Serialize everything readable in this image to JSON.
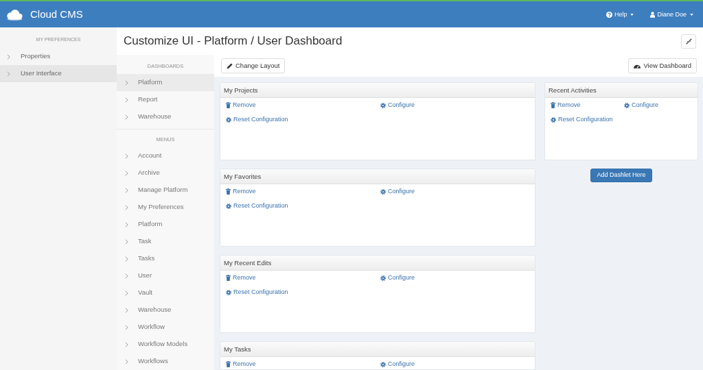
{
  "navbar": {
    "brand": "Cloud CMS",
    "menus": [
      {
        "kind": "help",
        "label": "Help"
      },
      {
        "kind": "user",
        "label": "Diane Doe"
      }
    ]
  },
  "sidebar": {
    "heading": "MY PREFERENCES",
    "items": [
      {
        "label": "Properties",
        "selected": false
      },
      {
        "label": "User Interface",
        "selected": true
      }
    ]
  },
  "header": {
    "title": "Customize UI - Platform / User Dashboard"
  },
  "subnav": {
    "sections": [
      {
        "heading": "DASHBOARDS",
        "items": [
          {
            "label": "Platform",
            "selected": true
          },
          {
            "label": "Report",
            "selected": false
          },
          {
            "label": "Warehouse",
            "selected": false
          }
        ]
      },
      {
        "heading": "MENUS",
        "items": [
          {
            "label": "Account",
            "selected": false
          },
          {
            "label": "Archive",
            "selected": false
          },
          {
            "label": "Manage Platform",
            "selected": false
          },
          {
            "label": "My Preferences",
            "selected": false
          },
          {
            "label": "Platform",
            "selected": false
          },
          {
            "label": "Task",
            "selected": false
          },
          {
            "label": "Tasks",
            "selected": false
          },
          {
            "label": "User",
            "selected": false
          },
          {
            "label": "Vault",
            "selected": false
          },
          {
            "label": "Warehouse",
            "selected": false
          },
          {
            "label": "Workflow",
            "selected": false
          },
          {
            "label": "Workflow Models",
            "selected": false
          },
          {
            "label": "Workflows",
            "selected": false
          }
        ]
      }
    ]
  },
  "toolbar": {
    "buttons": [
      {
        "kind": "edit",
        "label": "Change Layout"
      },
      {
        "kind": "view",
        "label": "View Dashboard"
      }
    ]
  },
  "columns": [
    {
      "dashlets": [
        {
          "title": "My Projects",
          "actions": [
            {
              "kind": "remove",
              "label": "Remove"
            },
            {
              "kind": "configure",
              "label": "Configure"
            },
            {
              "kind": "reset",
              "label": "Reset Configuration"
            }
          ]
        },
        {
          "title": "My Favorites",
          "actions": [
            {
              "kind": "remove",
              "label": "Remove"
            },
            {
              "kind": "configure",
              "label": "Configure"
            },
            {
              "kind": "reset",
              "label": "Reset Configuration"
            }
          ]
        },
        {
          "title": "My Recent Edits",
          "actions": [
            {
              "kind": "remove",
              "label": "Remove"
            },
            {
              "kind": "configure",
              "label": "Configure"
            },
            {
              "kind": "reset",
              "label": "Reset Configuration"
            }
          ]
        },
        {
          "title": "My Tasks",
          "actions": [
            {
              "kind": "remove",
              "label": "Remove"
            },
            {
              "kind": "configure",
              "label": "Configure"
            }
          ]
        }
      ]
    },
    {
      "dashlets": [
        {
          "title": "Recent Activities",
          "actions": [
            {
              "kind": "remove",
              "label": "Remove"
            },
            {
              "kind": "configure",
              "label": "Configure"
            },
            {
              "kind": "reset",
              "label": "Reset Configuration"
            }
          ]
        }
      ],
      "add_button": "Add Dashlet Here"
    }
  ]
}
